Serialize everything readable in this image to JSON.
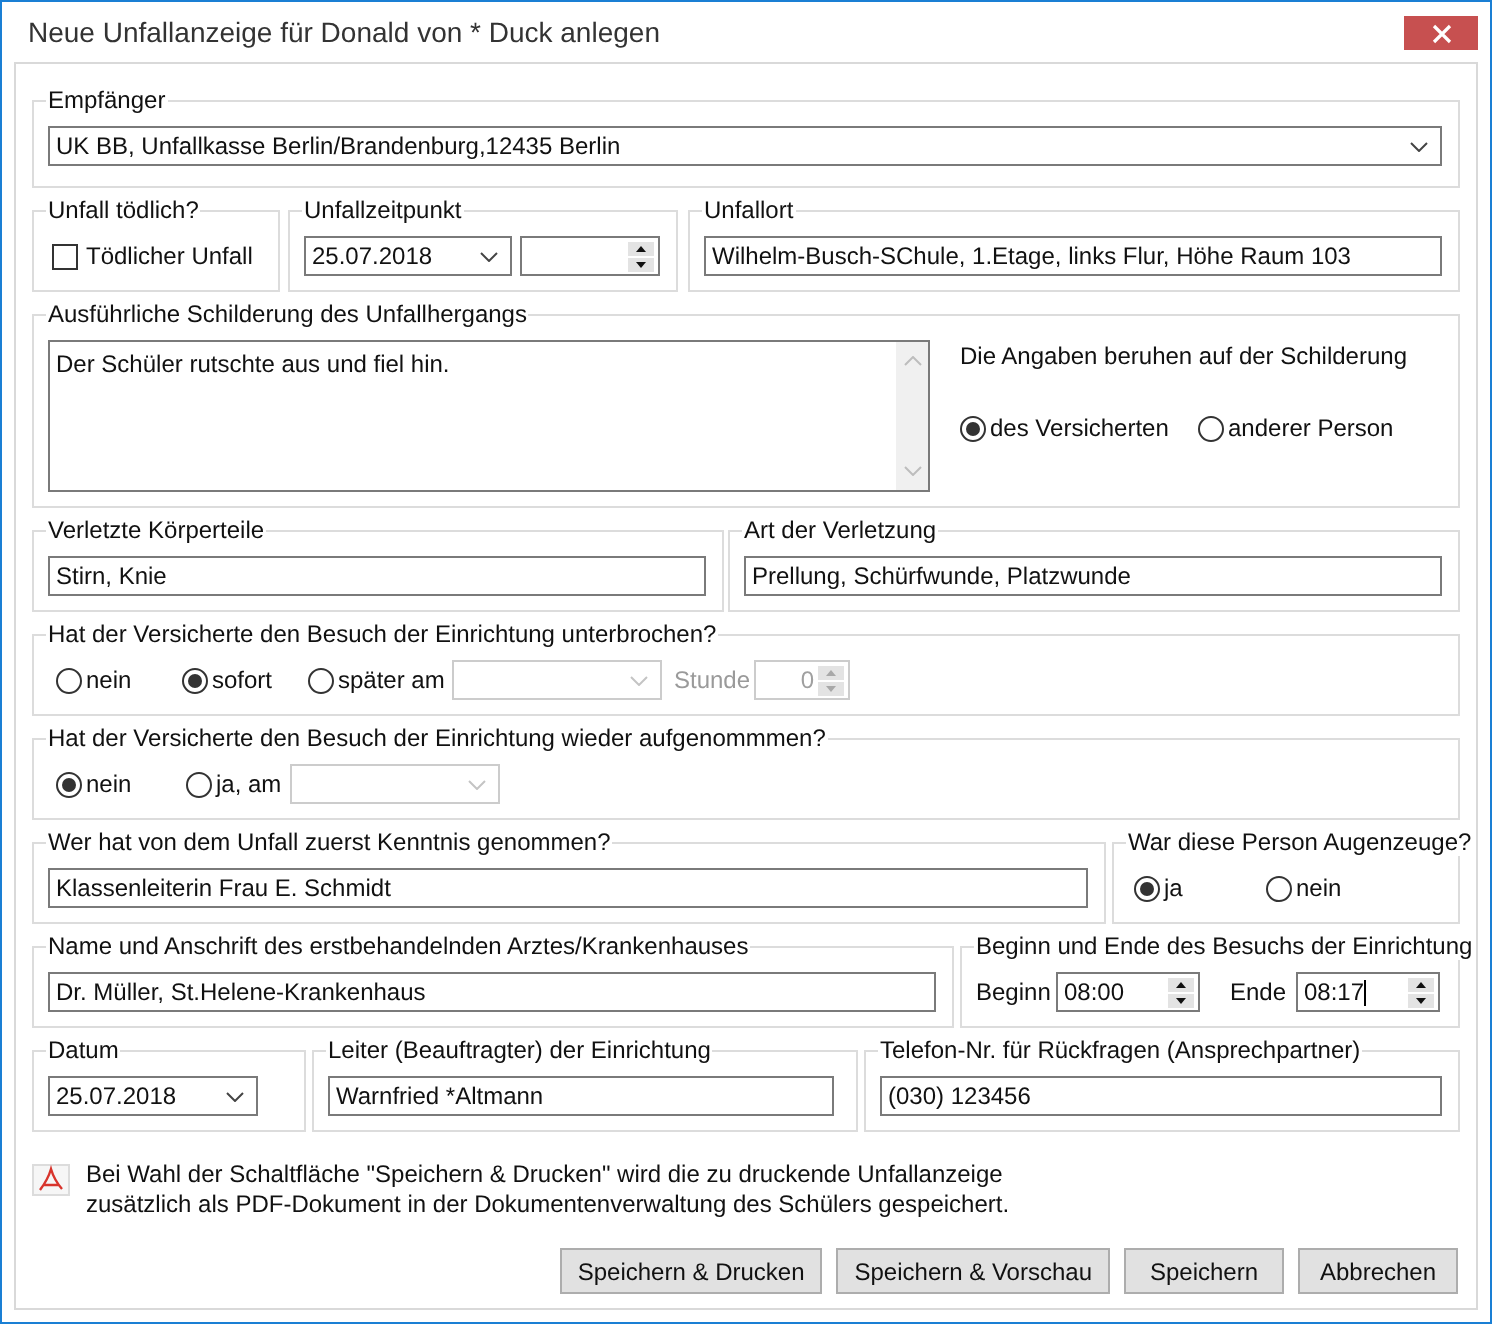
{
  "window": {
    "title": "Neue Unfallanzeige für Donald von * Duck anlegen"
  },
  "recipient": {
    "label": "Empfänger",
    "value": "UK BB, Unfallkasse Berlin/Brandenburg,12435 Berlin"
  },
  "fatal": {
    "label": "Unfall tödlich?",
    "checkbox_label": "Tödlicher Unfall",
    "checked": false
  },
  "accident_time": {
    "label": "Unfallzeitpunkt",
    "date": "25.07.2018"
  },
  "accident_place": {
    "label": "Unfallort",
    "value": "Wilhelm-Busch-SChule, 1.Etage, links Flur, Höhe Raum 103"
  },
  "description": {
    "label": "Ausführliche Schilderung des Unfallhergangs",
    "value": "Der Schüler rutschte aus und fiel hin.",
    "source_label": "Die Angaben beruhen auf der Schilderung",
    "source_options": [
      {
        "label": "des Versicherten",
        "selected": true
      },
      {
        "label": "anderer Person",
        "selected": false
      }
    ]
  },
  "injured_parts": {
    "label": "Verletzte Körperteile",
    "value": "Stirn, Knie"
  },
  "injury_type": {
    "label": "Art der Verletzung",
    "value": "Prellung, Schürfwunde, Platzwunde"
  },
  "interrupted": {
    "label": "Hat der Versicherte den Besuch der Einrichtung unterbrochen?",
    "options": [
      {
        "label": "nein",
        "selected": false
      },
      {
        "label": "sofort",
        "selected": true
      },
      {
        "label": "später am",
        "selected": false
      }
    ],
    "later_date": {
      "disabled": true
    },
    "hour": {
      "label": "Stunde",
      "value": "0",
      "disabled": true
    }
  },
  "resumed": {
    "label": "Hat der Versicherte den Besuch der Einrichtung wieder aufgenommmen?",
    "options": [
      {
        "label": "nein",
        "selected": true
      },
      {
        "label": "ja, am",
        "selected": false
      }
    ],
    "resume_date": {
      "disabled": true
    }
  },
  "first_informed": {
    "label": "Wer hat von dem Unfall zuerst Kenntnis genommen?",
    "value": "Klassenleiterin Frau E. Schmidt"
  },
  "eyewitness": {
    "label": "War diese Person Augenzeuge?",
    "options": [
      {
        "label": "ja",
        "selected": true
      },
      {
        "label": "nein",
        "selected": false
      }
    ]
  },
  "doctor": {
    "label": "Name und Anschrift des erstbehandelnden Arztes/Krankenhauses",
    "value": "Dr. Müller, St.Helene-Krankenhaus"
  },
  "attendance": {
    "label": "Beginn und Ende des Besuchs der Einrichtung",
    "start": {
      "label": "Beginn",
      "value": "08:00",
      "focused": false
    },
    "end": {
      "label": "Ende",
      "value": "08:17",
      "focused": true
    }
  },
  "report_date": {
    "label": "Datum",
    "value": "25.07.2018"
  },
  "head": {
    "label": "Leiter (Beauftragter) der Einrichtung",
    "value": "Warnfried *Altmann"
  },
  "phone": {
    "label": "Telefon-Nr. für Rückfragen (Ansprechpartner)",
    "value": "(030) 123456"
  },
  "info": {
    "text": "Bei Wahl der Schaltfläche \"Speichern & Drucken\" wird die zu druckende Unfallanzeige zusätzlich als PDF-Dokument in der Dokumentenverwaltung des Schülers gespeichert."
  },
  "buttons": [
    "Speichern & Drucken",
    "Speichern & Vorschau",
    "Speichern",
    "Abbrechen"
  ]
}
